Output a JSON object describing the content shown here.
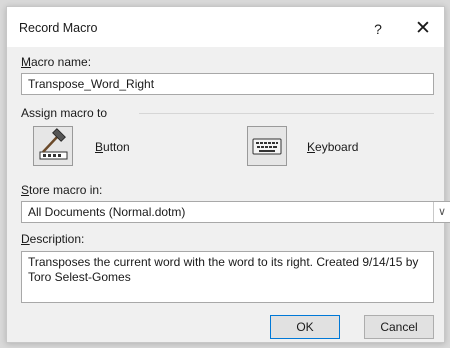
{
  "dialog": {
    "title": "Record Macro",
    "help_label": "?",
    "close_label": "✕"
  },
  "macro_name": {
    "label_access": "M",
    "label_rest": "acro name:",
    "value": "Transpose_Word_Right"
  },
  "assign": {
    "label": "Assign macro to",
    "button_access": "B",
    "button_rest": "utton",
    "keyboard_access": "K",
    "keyboard_rest": "eyboard"
  },
  "store": {
    "label_access": "S",
    "label_rest": "tore macro in:",
    "value": "All Documents (Normal.dotm)"
  },
  "description": {
    "label_access": "D",
    "label_rest": "escription:",
    "value": "Transposes the current word with the word to its right. Created 9/14/15 by Toro Selest-Gomes"
  },
  "footer": {
    "ok_label": "OK",
    "cancel_label": "Cancel"
  },
  "icons": {
    "assign_button": "hammer-toolbar-icon",
    "assign_keyboard": "keyboard-icon",
    "dropdown": "chevron-down-icon"
  }
}
